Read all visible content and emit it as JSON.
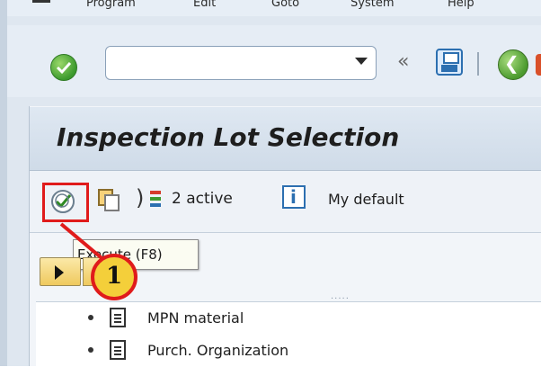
{
  "menu": {
    "items": [
      "Program",
      "Edit",
      "Goto",
      "System",
      "Help"
    ]
  },
  "toolbar": {
    "command_field_value": "",
    "back_symbol": "«"
  },
  "screen": {
    "title": "Inspection Lot Selection",
    "filter_label": "2 active",
    "variant_label": "My default",
    "tooltip": "Execute   (F8)"
  },
  "callout": {
    "number": "1",
    "color": "#e01b1b",
    "fill": "#f4cf3a"
  },
  "tree": {
    "items": [
      {
        "label": "MPN material",
        "icon": "document-icon"
      },
      {
        "label": "Purch. Organization",
        "icon": "document-icon"
      }
    ]
  },
  "icons": [
    "check-icon",
    "save-icon",
    "back-icon",
    "execute-icon",
    "copy-icon",
    "filter-icon",
    "info-icon",
    "expand-icon"
  ]
}
